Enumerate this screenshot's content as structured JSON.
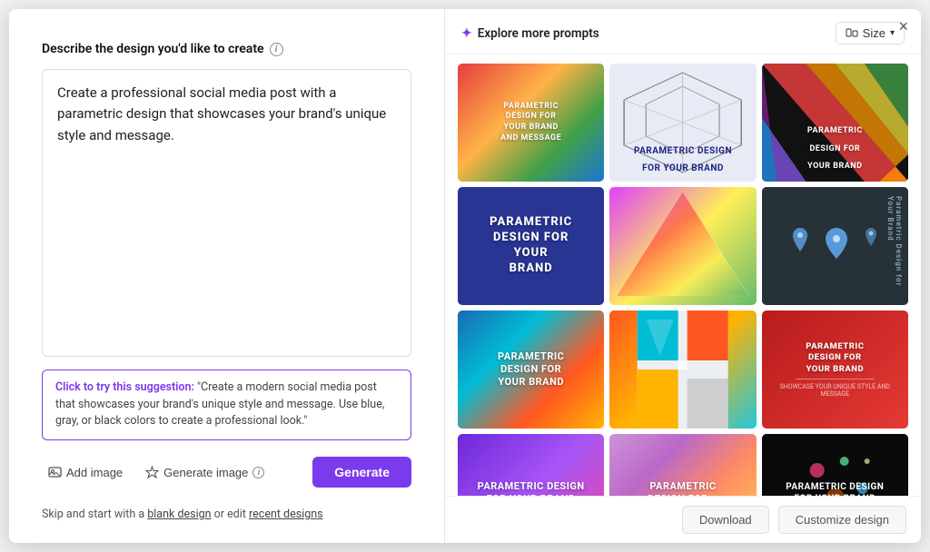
{
  "modal": {
    "close_label": "×"
  },
  "left": {
    "section_title": "Describe the design you'd like to create",
    "textarea_value": "Create a professional social media post with a parametric design that showcases your brand's unique style and message.",
    "suggestion_prefix": "Click to try this suggestion:",
    "suggestion_quote": "\"Create a modern social media post that showcases your brand's unique style and message. Use blue, gray, or black colors to create a professional look.\"",
    "add_image_label": "Add image",
    "generate_image_label": "Generate image",
    "generate_btn_label": "Generate",
    "footer_text": "Skip and start with a ",
    "blank_design_label": "blank design",
    "footer_text2": " or edit ",
    "recent_designs_label": "recent designs"
  },
  "right": {
    "explore_label": "Explore more prompts",
    "size_label": "Size",
    "cards": [
      {
        "id": 1,
        "text": "PARAMETRIC DESIGN FOR YOUR BRAND AND MESSAGE",
        "style": "card-1"
      },
      {
        "id": 2,
        "text": "Parametric Design for Your Brand",
        "style": "card-2",
        "text_class": "card-text-blue"
      },
      {
        "id": 3,
        "text": "PARAMETRIC DESIGN FOR YOUR BRAND",
        "style": "card-3"
      },
      {
        "id": 4,
        "text": "PARAMETRIC DESIGN FOR YOUR BRAND",
        "style": "card-4"
      },
      {
        "id": 5,
        "text": "",
        "style": "card-5"
      },
      {
        "id": 6,
        "text": "PARAMETRIC DESIGN FOR YOUR BRAND",
        "style": "card-6"
      },
      {
        "id": 7,
        "text": "Parametric Design for Your Brand",
        "style": "card-7"
      },
      {
        "id": 8,
        "text": "",
        "style": "card-8"
      },
      {
        "id": 9,
        "text": "PARAMETRIC DESIGN FOR YOUR BRAND",
        "style": "card-9"
      },
      {
        "id": 10,
        "text": "Parametric Design for Your Brand",
        "style": "card-10"
      },
      {
        "id": 11,
        "text": "Parametric Design for Your Brand",
        "style": "card-11",
        "text_class": "card-text-dark"
      },
      {
        "id": 12,
        "text": "Parametric Design for Your Brand",
        "style": "card-12"
      }
    ],
    "download_label": "Download",
    "customize_label": "Customize design"
  }
}
